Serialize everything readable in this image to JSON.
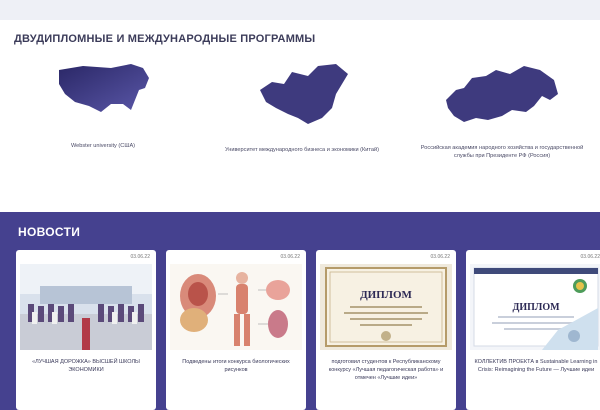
{
  "programs_section": {
    "title": "ДВУДИПЛОМНЫЕ И МЕЖДУНАРОДНЫЕ ПРОГРАММЫ",
    "programs": [
      {
        "map": "usa-map",
        "caption": "Webster university (США)"
      },
      {
        "map": "china-map",
        "caption": "Университет международного бизнеса и экономики (Китай)"
      },
      {
        "map": "russia-map",
        "caption": "Российская академия народного хозяйства и государственной службы при Президенте РФ (Россия)"
      }
    ]
  },
  "news_section": {
    "title": "НОВОСТИ",
    "cards": [
      {
        "date": "03.06.22",
        "text": "«ЛУЧШАЯ ДОРОЖКА» ВЫСШЕЙ ШКОЛЫ ЭКОНОМИКИ"
      },
      {
        "date": "03.06.22",
        "text": "Подведены итоги конкурса биологических рисунков"
      },
      {
        "date": "03.06.22",
        "text": "подготовил студентов к Республиканскому конкурсу «Лучшая педагогическая работа» и отмечен «Лучшие идеи»"
      },
      {
        "date": "03.06.22",
        "text": "КОЛЛЕКТИВ ПРОЕКТА в Sustainable Learning in Crisis: Reimagining the Future — Лучшие идеи"
      }
    ]
  },
  "colors": {
    "accent": "#45418f",
    "map_fill": "#3e3a7e"
  }
}
